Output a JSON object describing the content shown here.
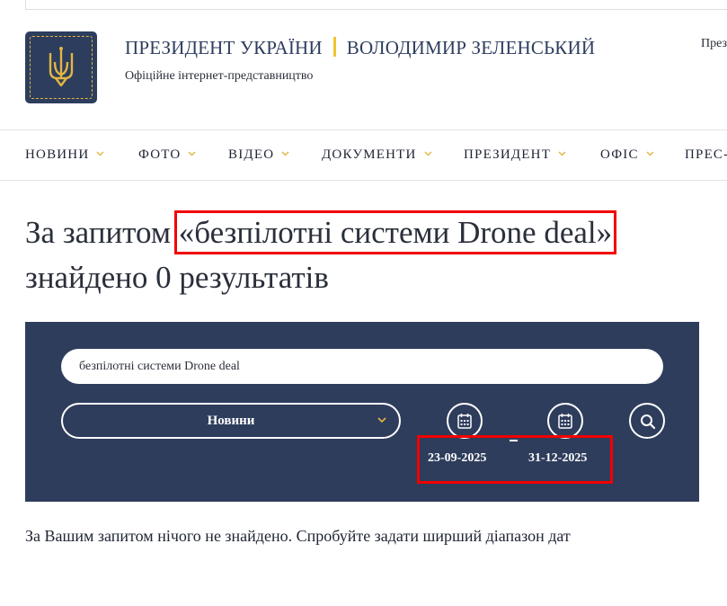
{
  "header": {
    "title_left": "ПРЕЗИДЕНТ УКРАЇНИ",
    "title_right": "ВОЛОДИМИР ЗЕЛЕНСЬКИЙ",
    "subtitle": "Офіційне інтернет-представництво",
    "right_cut_text": "През",
    "logo_icon": "trident-emblem-icon",
    "colors": {
      "brand_navy": "#2d3d5e",
      "accent_gold": "#f2c230"
    }
  },
  "nav": {
    "items": [
      {
        "label": "НОВИНИ"
      },
      {
        "label": "ФОТО"
      },
      {
        "label": "ВІДЕО"
      },
      {
        "label": "ДОКУМЕНТИ"
      },
      {
        "label": "ПРЕЗИДЕНТ"
      },
      {
        "label": "ОФІС"
      },
      {
        "label": "ПРЕС-"
      }
    ]
  },
  "heading": {
    "prefix": "За запитом",
    "query": "«безпілотні системи Drone deal»",
    "suffix": "знайдено 0 результатів"
  },
  "search": {
    "query_value": "безпілотні системи Drone deal",
    "category_selected": "Новини",
    "date_from": "23-09-2025",
    "date_to": "31-12-2025",
    "panel_color": "#2e3d5c"
  },
  "result": {
    "message": "За Вашим запитом нічого не знайдено. Спробуйте задати ширший діапазон дат"
  },
  "annotation_color": "#f20000"
}
